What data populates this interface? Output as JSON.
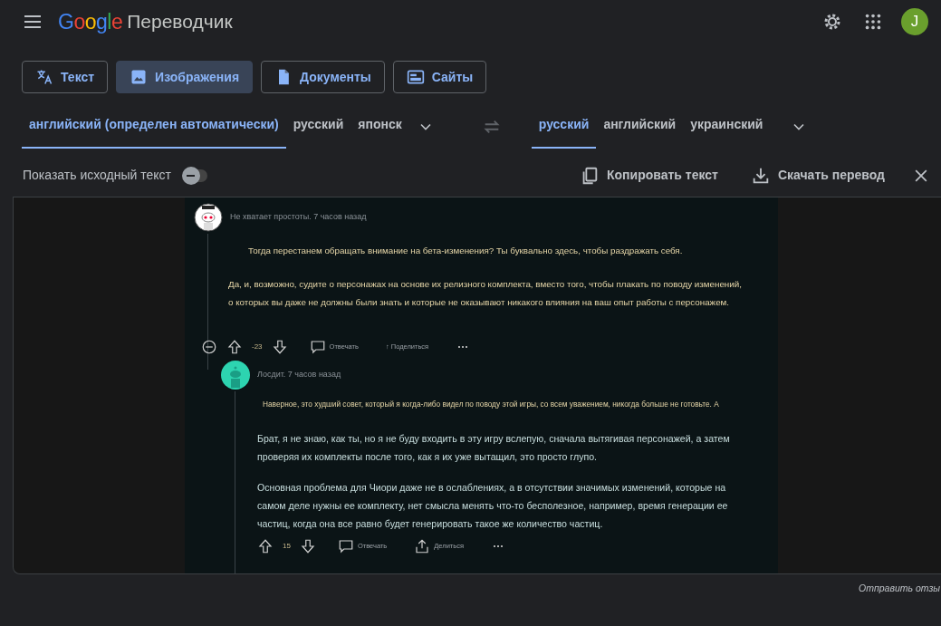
{
  "header": {
    "logo": "Google",
    "app_name": "Переводчик",
    "avatar": "J"
  },
  "mode_tabs": [
    {
      "label": "Текст",
      "selected": false
    },
    {
      "label": "Изображения",
      "selected": true
    },
    {
      "label": "Документы",
      "selected": false
    },
    {
      "label": "Сайты",
      "selected": false
    }
  ],
  "source_languages": [
    {
      "label": "английский (определен автоматически)",
      "selected": true
    },
    {
      "label": "русский",
      "selected": false
    },
    {
      "label": "японск",
      "selected": false
    }
  ],
  "target_languages": [
    {
      "label": "русский",
      "selected": true
    },
    {
      "label": "английский",
      "selected": false
    },
    {
      "label": "украинский",
      "selected": false
    }
  ],
  "original_toggle": {
    "label": "Показать исходный текст",
    "on": false
  },
  "actions": [
    {
      "label": "Копировать текст"
    },
    {
      "label": "Скачать перевод"
    }
  ],
  "comments": [
    {
      "meta": "Не хватает простоты. 7 часов назад",
      "paragraphs": [
        "Тогда перестанем обращать внимание на бета-изменения? Ты буквально здесь, чтобы раздражать себя.",
        "Да, и, возможно, судите о персонажах на основе их релизного комплекта, вместо того, чтобы плакать по поводу изменений, о которых вы даже не должны были знать и которые не оказывают никакого влияния на ваш опыт работы с персонажем."
      ],
      "votes": "-23",
      "reply": "Отвечать",
      "share": "↑ Поделиться",
      "collapse": true
    },
    {
      "meta": "Лосдит. 7 часов назад",
      "paragraphs": [
        "Наверное, это худший совет, который я когда-либо видел по поводу этой игры, со всем уважением, никогда больше не готовьте. А",
        "Брат, я не знаю, как ты, но я не буду входить в эту игру вслепую, сначала вытягивая персонажей, а затем проверяя их комплекты после того, как я их уже вытащил, это просто глупо.",
        "Основная проблема для Чиори даже не в ослаблениях, а в отсутствии значимых изменений, которые на самом деле нужны ее комплекту, нет смысла менять что-то бесполезное, например, время генерации ее частиц, когда она все равно будет генерировать такое же количество частиц."
      ],
      "votes": "15",
      "reply": "Отвечать",
      "share": "Делиться",
      "collapse": false
    }
  ],
  "feedback_link": "Отправить отзы"
}
